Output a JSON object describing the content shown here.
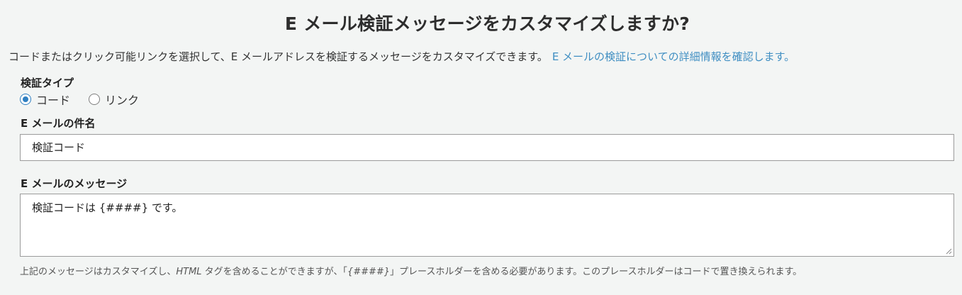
{
  "page": {
    "title": "E メール検証メッセージをカスタマイズしますか?",
    "description": "コードまたはクリック可能リンクを選択して、E メールアドレスを検証するメッセージをカスタマイズできます。",
    "learn_more_link": "E メールの検証についての詳細情報を確認します。"
  },
  "verification_type": {
    "label": "検証タイプ",
    "options": [
      {
        "label": "コード",
        "selected": true
      },
      {
        "label": "リンク",
        "selected": false
      }
    ]
  },
  "email_subject": {
    "label": "E メールの件名",
    "value": "検証コード"
  },
  "email_message": {
    "label": "E メールのメッセージ",
    "value": "検証コードは {####} です。"
  },
  "hint": {
    "part1": "上記のメッセージはカスタマイズし、",
    "html_text": "HTML",
    "part2": " タグを含めることができますが、「",
    "placeholder_text": "{####}",
    "part3": "」プレースホルダーを含める必要があります。このプレースホルダーはコードで置き換えられます。"
  },
  "colors": {
    "accent": "#2f7fc1",
    "link": "#3f8ec2",
    "background": "#f3f5f4"
  }
}
